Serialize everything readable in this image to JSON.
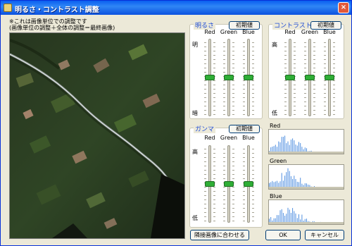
{
  "window": {
    "title": "明るさ・コントラスト調整",
    "close_glyph": "×"
  },
  "notes": {
    "line1": "※これは画像単位での調整です",
    "line2": "(画像単位の調整＋全体の調整＝最終画像)"
  },
  "brightness": {
    "title": "明るさ",
    "reset_label": "初期値",
    "channels": [
      "Red",
      "Green",
      "Blue"
    ],
    "top_label": "明",
    "bottom_label": "暗",
    "levels": [
      0.5,
      0.5,
      0.5
    ]
  },
  "contrast": {
    "title": "コントラスト",
    "reset_label": "初期値",
    "channels": [
      "Red",
      "Green",
      "Blue"
    ],
    "top_label": "高",
    "bottom_label": "低",
    "levels": [
      0.5,
      0.5,
      0.5
    ]
  },
  "gamma": {
    "title": "ガンマ",
    "reset_label": "初期値",
    "channels": [
      "Red",
      "Green",
      "Blue"
    ],
    "top_label": "高",
    "bottom_label": "低",
    "levels": [
      0.5,
      0.5,
      0.5
    ]
  },
  "histograms": {
    "red_label": "Red",
    "green_label": "Green",
    "blue_label": "Blue",
    "bar_color": "#4f8fe0"
  },
  "buttons": {
    "match_adjacent": "隣接画像に合わせる",
    "ok": "OK",
    "cancel": "キャンセル"
  }
}
